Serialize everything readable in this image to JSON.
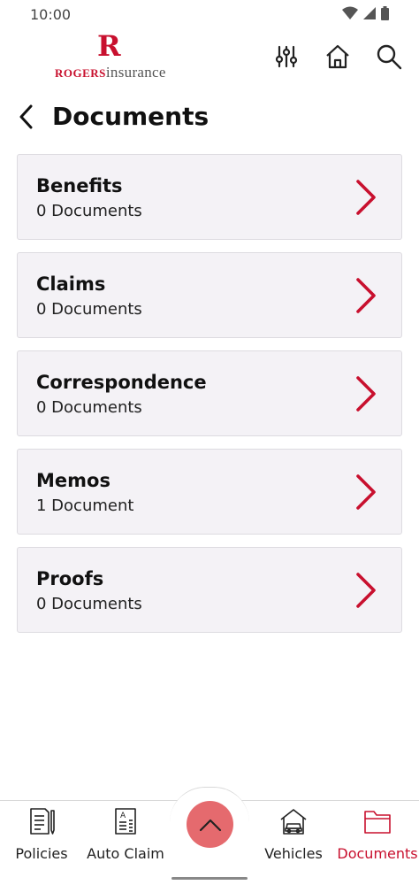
{
  "status_bar": {
    "time": "10:00"
  },
  "header": {
    "logo_letter": "R",
    "logo_brand_strong": "ROGERS",
    "logo_brand_light": "insurance"
  },
  "page": {
    "title": "Documents"
  },
  "documents": [
    {
      "name": "Benefits",
      "count": "0 Documents"
    },
    {
      "name": "Claims",
      "count": "0 Documents"
    },
    {
      "name": "Correspondence",
      "count": "0 Documents"
    },
    {
      "name": "Memos",
      "count": "1 Document"
    },
    {
      "name": "Proofs",
      "count": "0 Documents"
    }
  ],
  "bottom_nav": {
    "items": [
      {
        "label": "Policies",
        "icon": "policies-icon"
      },
      {
        "label": "Auto Claim",
        "icon": "auto-claim-icon"
      },
      {
        "label": "Vehicles",
        "icon": "vehicles-icon"
      },
      {
        "label": "Documents",
        "icon": "documents-folder-icon",
        "active": true
      }
    ],
    "fab_icon": "chevron-up-icon"
  },
  "colors": {
    "accent": "#c8102e",
    "fab": "#e56a6e",
    "card_bg": "#f4f2f6"
  }
}
